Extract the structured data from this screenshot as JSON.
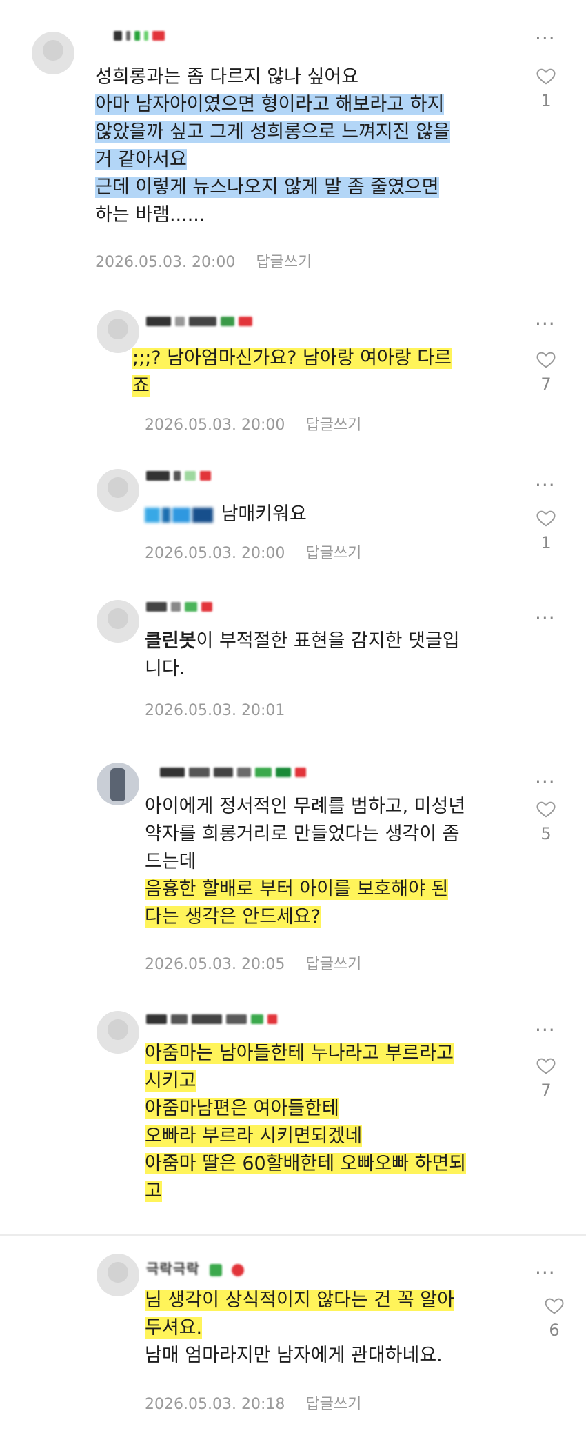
{
  "comments": [
    {
      "lines": [
        "성희롱과는 좀 다르지 않나 싶어요",
        "아마 남자아이였으면 형이라고 해보라고 하지",
        "않았을까 싶고 그게 성희롱으로 느껴지진 않을",
        "거 같아서요",
        "근데 이렇게 뉴스나오지 않게 말 좀 줄였으면",
        "하는 바램......"
      ],
      "date": "2026.05.03. 20:00",
      "reply": "답글쓰기",
      "likes": "1"
    },
    {
      "lines": [
        ";;;? 남아엄마신가요? 남아랑 여아랑 다르",
        "죠"
      ],
      "date": "2026.05.03. 20:00",
      "reply": "답글쓰기",
      "likes": "7"
    },
    {
      "lines": [
        "남매키워요"
      ],
      "date": "2026.05.03. 20:00",
      "reply": "답글쓰기",
      "likes": "1"
    },
    {
      "bot": "클린봇",
      "lines": [
        "이 부적절한 표현을 감지한 댓글입",
        "니다."
      ],
      "date": "2026.05.03. 20:01",
      "reply": ""
    },
    {
      "lines": [
        "아이에게 정서적인 무례를 범하고, 미성년",
        "약자를 희롱거리로 만들었다는 생각이 좀",
        "드는데",
        "음흉한 할배로 부터 아이를 보호해야 된",
        "다는 생각은 안드세요?"
      ],
      "date": "2026.05.03. 20:05",
      "reply": "답글쓰기",
      "likes": "5"
    },
    {
      "lines": [
        "아줌마는 남아들한테 누나라고 부르라고",
        "시키고",
        "아줌마남편은 여아들한테",
        "오빠라 부르라 시키면되겠네",
        "아줌마 딸은 60할배한테 오빠오빠 하면되",
        "고"
      ],
      "date": "",
      "reply": "",
      "likes": "7"
    },
    {
      "nick": "극락극락",
      "lines": [
        "님 생각이 상식적이지 않다는 건 꼭 알아",
        "두셔요.",
        "남매 엄마라지만 남자에게 관대하네요."
      ],
      "date": "2026.05.03. 20:18",
      "reply": "답글쓰기",
      "likes": "6"
    }
  ],
  "ui": {
    "more": "···"
  },
  "colors": {
    "blue_highlight": "#b3d6f7",
    "yellow_highlight": "#fff45a",
    "meta_gray": "#9a9a9a"
  }
}
